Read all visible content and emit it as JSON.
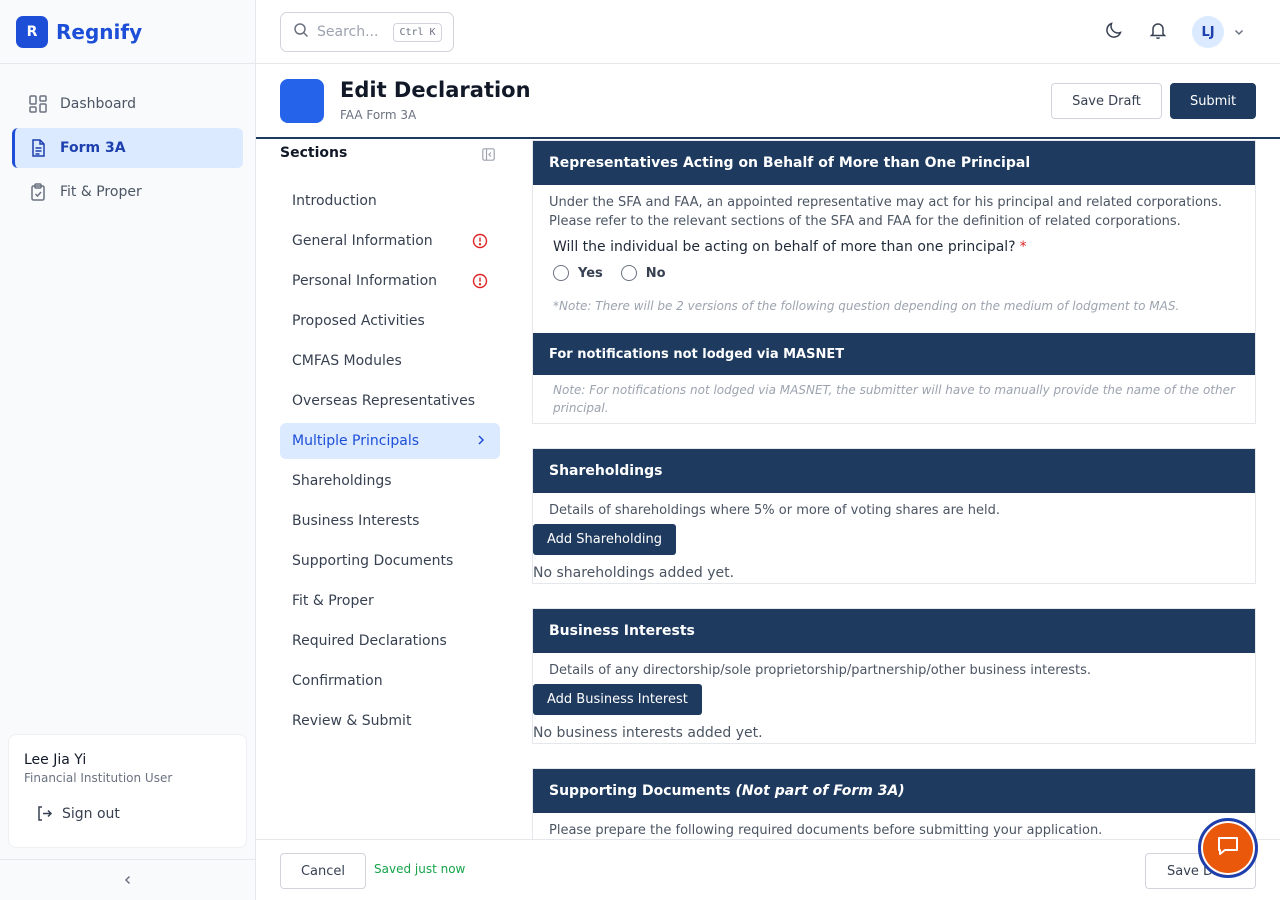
{
  "brand": {
    "logo_letter": "R",
    "name": "Regnify"
  },
  "nav": {
    "items": [
      {
        "label": "Dashboard",
        "icon": "dashboard-icon"
      },
      {
        "label": "Form 3A",
        "icon": "document-icon",
        "active": true
      },
      {
        "label": "Fit & Proper",
        "icon": "clipboard-check-icon"
      }
    ]
  },
  "user": {
    "name": "Lee Jia Yi",
    "role": "Financial Institution User",
    "signout": "Sign out"
  },
  "topbar": {
    "search_placeholder": "Search...",
    "shortcut": "Ctrl K",
    "avatar_initials": "LJ"
  },
  "header": {
    "title": "Edit Declaration",
    "subtitle": "FAA Form 3A",
    "save_draft": "Save Draft",
    "submit": "Submit"
  },
  "sections": {
    "title": "Sections",
    "items": [
      {
        "label": "Introduction"
      },
      {
        "label": "General Information",
        "error": true
      },
      {
        "label": "Personal Information",
        "error": true
      },
      {
        "label": "Proposed Activities"
      },
      {
        "label": "CMFAS Modules"
      },
      {
        "label": "Overseas Representatives"
      },
      {
        "label": "Multiple Principals",
        "active": true
      },
      {
        "label": "Shareholdings"
      },
      {
        "label": "Business Interests"
      },
      {
        "label": "Supporting Documents"
      },
      {
        "label": "Fit & Proper"
      },
      {
        "label": "Required Declarations"
      },
      {
        "label": "Confirmation"
      },
      {
        "label": "Review & Submit"
      }
    ]
  },
  "multiple_principals": {
    "heading": "Representatives Acting on Behalf of More than One Principal",
    "description": "Under the SFA and FAA, an appointed representative may act for his principal and related corporations. Please refer to the relevant sections of the SFA and FAA for the definition of related corporations.",
    "question": "Will the individual be acting on behalf of more than one principal?",
    "required_mark": "*",
    "option_yes": "Yes",
    "option_no": "No",
    "note": "*Note: There will be 2 versions of the following question depending on the medium of lodgment to MAS.",
    "sub_heading": "For notifications not lodged via MASNET",
    "sub_note": "Note: For notifications not lodged via MASNET, the submitter will have to manually provide the name of the other principal."
  },
  "shareholdings": {
    "heading": "Shareholdings",
    "description": "Details of shareholdings where 5% or more of voting shares are held.",
    "add_button": "Add Shareholding",
    "empty": "No shareholdings added yet."
  },
  "business_interests": {
    "heading": "Business Interests",
    "description": "Details of any directorship/sole proprietorship/partnership/other business interests.",
    "add_button": "Add Business Interest",
    "empty": "No business interests added yet."
  },
  "supporting_documents": {
    "heading": "Supporting Documents",
    "heading_note": "(Not part of Form 3A)",
    "description": "Please prepare the following required documents before submitting your application."
  },
  "footer": {
    "cancel": "Cancel",
    "saved_status": "Saved just now",
    "save_button": "Save Draft"
  },
  "colors": {
    "brand": "#1d4ed8",
    "header_dark": "#1e3a5f",
    "error": "#dc2626",
    "success": "#16a34a",
    "fab": "#ea580c"
  }
}
